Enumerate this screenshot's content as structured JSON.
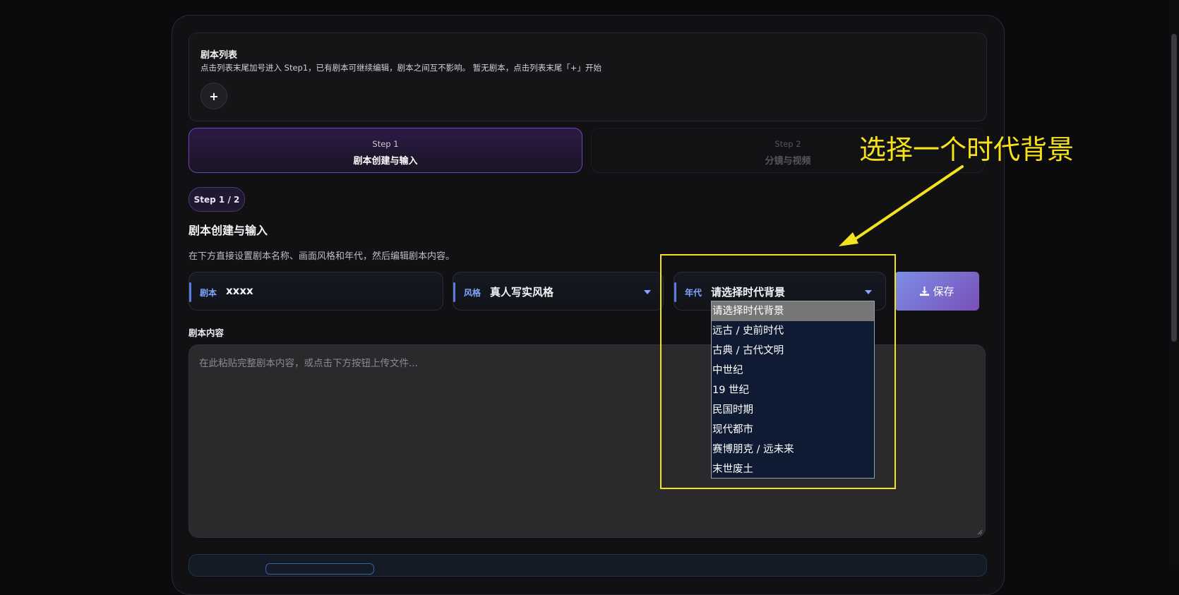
{
  "script_list": {
    "title": "剧本列表",
    "description": "点击列表末尾加号进入 Step1，已有剧本可继续编辑，剧本之间互不影响。  暂无剧本，点击列表末尾「+」开始",
    "add_label": "+"
  },
  "steps": [
    {
      "step": "Step 1",
      "name": "剧本创建与输入"
    },
    {
      "step": "Step 2",
      "name": "分镜与视频"
    }
  ],
  "progress_pill": "Step 1 / 2",
  "section": {
    "title": "剧本创建与输入",
    "description": "在下方直接设置剧本名称、画面风格和年代，然后编辑剧本内容。"
  },
  "fields": {
    "script": {
      "label": "剧本",
      "value": "xxxx"
    },
    "style": {
      "label": "风格",
      "value": "真人写实风格"
    },
    "era": {
      "label": "年代",
      "value": "请选择时代背景"
    }
  },
  "save_label": "保存",
  "content": {
    "label": "剧本内容",
    "placeholder": "在此粘贴完整剧本内容，或点击下方按钮上传文件..."
  },
  "era_options": [
    "请选择时代背景",
    "远古 / 史前时代",
    "古典 / 古代文明",
    "中世纪",
    "19 世纪",
    "民国时期",
    "现代都市",
    "赛博朋克 / 远未来",
    "末世废土"
  ],
  "annotation": "选择一个时代背景",
  "colors": {
    "accent": "#7b8fe6",
    "annotation": "#f5e21c",
    "field_label": "#7fa7ff"
  }
}
